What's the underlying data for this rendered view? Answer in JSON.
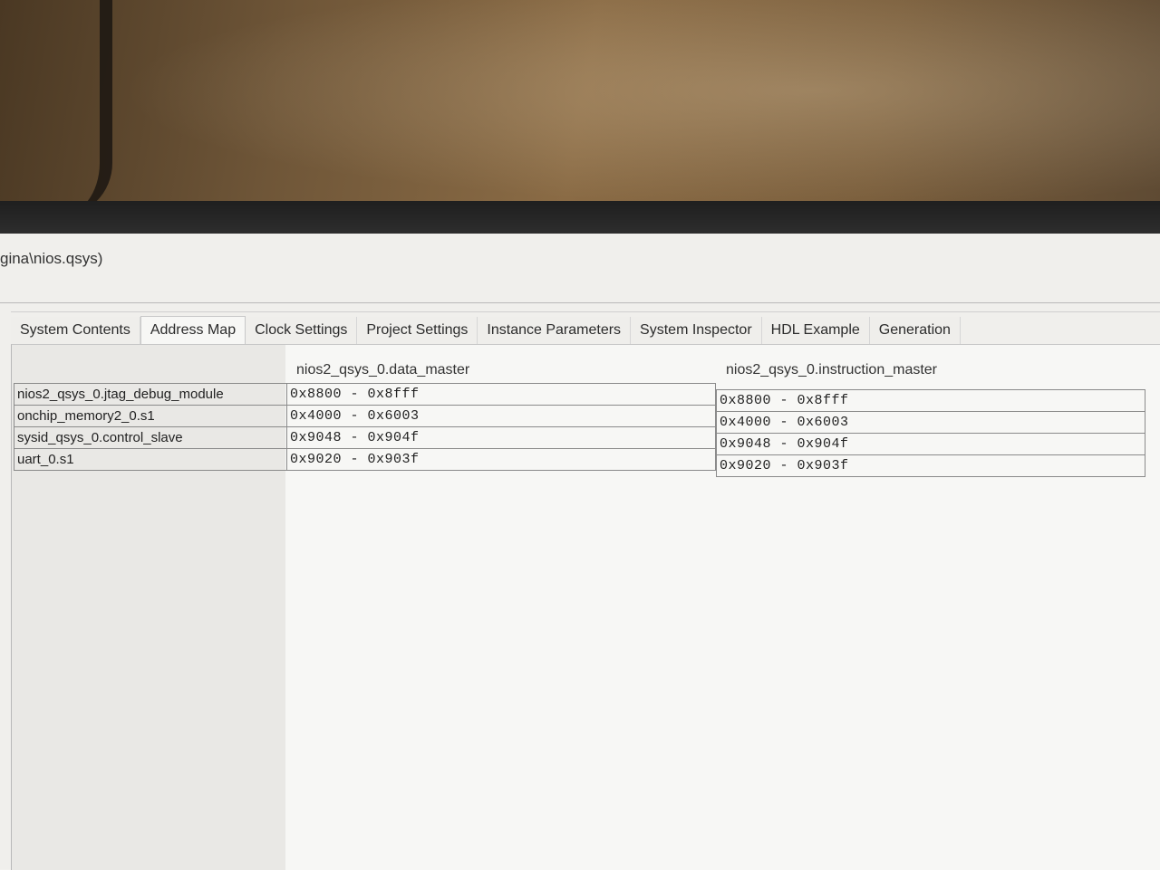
{
  "window": {
    "title": "gina\\nios.qsys)"
  },
  "tabs": [
    {
      "label": "System Contents",
      "active": false
    },
    {
      "label": "Address Map",
      "active": true
    },
    {
      "label": "Clock Settings",
      "active": false
    },
    {
      "label": "Project Settings",
      "active": false
    },
    {
      "label": "Instance Parameters",
      "active": false
    },
    {
      "label": "System Inspector",
      "active": false
    },
    {
      "label": "HDL Example",
      "active": false
    },
    {
      "label": "Generation",
      "active": false
    }
  ],
  "address_map": {
    "columns": [
      "nios2_qsys_0.data_master",
      "nios2_qsys_0.instruction_master"
    ],
    "rows": [
      {
        "slave": "nios2_qsys_0.jtag_debug_module",
        "data_master": "0x8800 - 0x8fff",
        "instruction_master": "0x8800 - 0x8fff"
      },
      {
        "slave": "onchip_memory2_0.s1",
        "data_master": "0x4000 - 0x6003",
        "instruction_master": "0x4000 - 0x6003"
      },
      {
        "slave": "sysid_qsys_0.control_slave",
        "data_master": "0x9048 - 0x904f",
        "instruction_master": "0x9048 - 0x904f"
      },
      {
        "slave": "uart_0.s1",
        "data_master": "0x9020 - 0x903f",
        "instruction_master": "0x9020 - 0x903f"
      }
    ]
  }
}
